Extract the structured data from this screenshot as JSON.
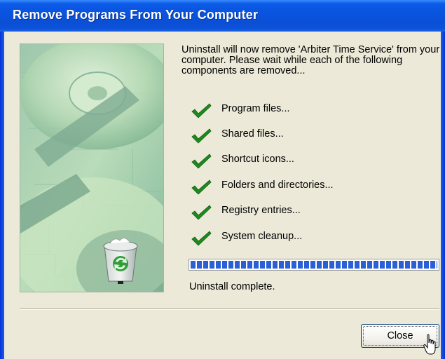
{
  "window": {
    "title": "Remove Programs From Your Computer",
    "accent_color": "#0a54df"
  },
  "message": "Uninstall will now remove  'Arbiter Time Service' from your computer.  Please wait while each of the following components are removed...",
  "steps": [
    {
      "label": "Program files...",
      "status": "done",
      "icon": "checkmark-icon"
    },
    {
      "label": "Shared files...",
      "status": "done",
      "icon": "checkmark-icon"
    },
    {
      "label": "Shortcut icons...",
      "status": "done",
      "icon": "checkmark-icon"
    },
    {
      "label": "Folders and directories...",
      "status": "done",
      "icon": "checkmark-icon"
    },
    {
      "label": "Registry entries...",
      "status": "done",
      "icon": "checkmark-icon"
    },
    {
      "label": "System cleanup...",
      "status": "done",
      "icon": "checkmark-icon"
    }
  ],
  "progress": {
    "value_percent": 100,
    "color": "#2a5fd6"
  },
  "status_text": "Uninstall complete.",
  "buttons": {
    "close_label": "Close"
  },
  "check_color": "#1e8a1e"
}
